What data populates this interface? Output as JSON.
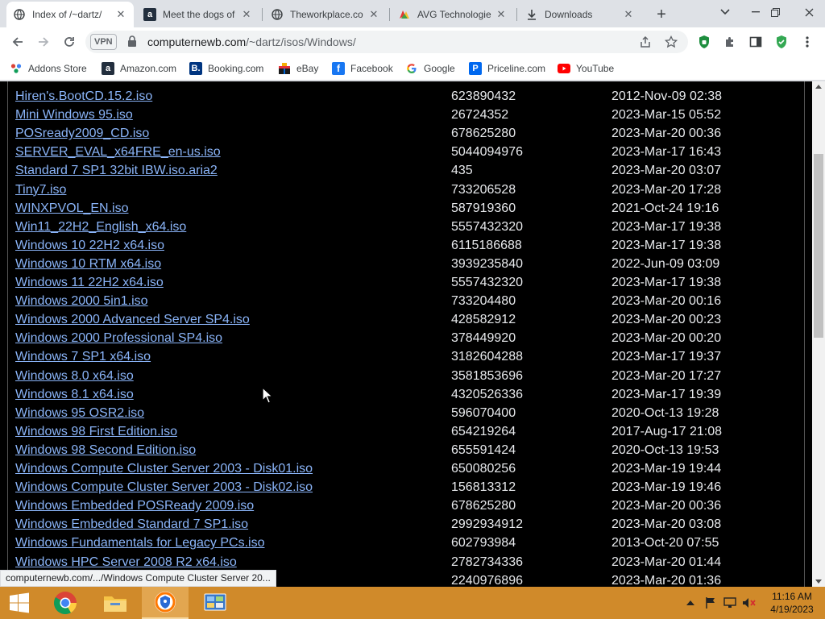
{
  "browser": {
    "tabs": [
      {
        "title": "Index of /~dartz/",
        "favicon": "globe-icon",
        "active": true
      },
      {
        "title": "Meet the dogs of",
        "favicon": "amazon-icon",
        "active": false
      },
      {
        "title": "Theworkplace.co",
        "favicon": "globe-icon",
        "active": false
      },
      {
        "title": "AVG Technologie",
        "favicon": "avg-icon",
        "active": false
      },
      {
        "title": "Downloads",
        "favicon": "download-icon",
        "active": false
      }
    ],
    "vpn_label": "VPN",
    "url_domain": "computernewb.com",
    "url_path": "/~dartz/isos/Windows/",
    "bookmarks": [
      {
        "label": "Addons Store",
        "icon": "addons-store-icon"
      },
      {
        "label": "Amazon.com",
        "icon": "amazon-icon"
      },
      {
        "label": "Booking.com",
        "icon": "booking-icon"
      },
      {
        "label": "eBay",
        "icon": "ebay-icon"
      },
      {
        "label": "Facebook",
        "icon": "facebook-icon"
      },
      {
        "label": "Google",
        "icon": "google-icon"
      },
      {
        "label": "Priceline.com",
        "icon": "priceline-icon"
      },
      {
        "label": "YouTube",
        "icon": "youtube-icon"
      }
    ],
    "status_url": "computernewb.com/.../Windows Compute Cluster Server 20..."
  },
  "listing": {
    "rows": [
      {
        "name": "Hiren's.BootCD.15.2.iso",
        "size": "623890432",
        "date": "2012-Nov-09 02:38"
      },
      {
        "name": "Mini Windows 95.iso",
        "size": "26724352",
        "date": "2023-Mar-15 05:52"
      },
      {
        "name": "POSready2009_CD.iso",
        "size": "678625280",
        "date": "2023-Mar-20 00:36"
      },
      {
        "name": "SERVER_EVAL_x64FRE_en-us.iso",
        "size": "5044094976",
        "date": "2023-Mar-17 16:43"
      },
      {
        "name": "Standard 7 SP1 32bit IBW.iso.aria2",
        "size": "435",
        "date": "2023-Mar-20 03:07"
      },
      {
        "name": "Tiny7.iso",
        "size": "733206528",
        "date": "2023-Mar-20 17:28"
      },
      {
        "name": "WINXPVOL_EN.iso",
        "size": "587919360",
        "date": "2021-Oct-24 19:16"
      },
      {
        "name": "Win11_22H2_English_x64.iso",
        "size": "5557432320",
        "date": "2023-Mar-17 19:38"
      },
      {
        "name": "Windows 10 22H2 x64.iso",
        "size": "6115186688",
        "date": "2023-Mar-17 19:38"
      },
      {
        "name": "Windows 10 RTM x64.iso",
        "size": "3939235840",
        "date": "2022-Jun-09 03:09"
      },
      {
        "name": "Windows 11 22H2 x64.iso",
        "size": "5557432320",
        "date": "2023-Mar-17 19:38"
      },
      {
        "name": "Windows 2000 5in1.iso",
        "size": "733204480",
        "date": "2023-Mar-20 00:16"
      },
      {
        "name": "Windows 2000 Advanced Server SP4.iso",
        "size": "428582912",
        "date": "2023-Mar-20 00:23"
      },
      {
        "name": "Windows 2000 Professional SP4.iso",
        "size": "378449920",
        "date": "2023-Mar-20 00:20"
      },
      {
        "name": "Windows 7 SP1 x64.iso",
        "size": "3182604288",
        "date": "2023-Mar-17 19:37"
      },
      {
        "name": "Windows 8.0 x64.iso",
        "size": "3581853696",
        "date": "2023-Mar-20 17:27"
      },
      {
        "name": "Windows 8.1 x64.iso",
        "size": "4320526336",
        "date": "2023-Mar-17 19:39"
      },
      {
        "name": "Windows 95 OSR2.iso",
        "size": "596070400",
        "date": "2020-Oct-13 19:28"
      },
      {
        "name": "Windows 98 First Edition.iso",
        "size": "654219264",
        "date": "2017-Aug-17 21:08"
      },
      {
        "name": "Windows 98 Second Edition.iso",
        "size": "655591424",
        "date": "2020-Oct-13 19:53"
      },
      {
        "name": "Windows Compute Cluster Server 2003 - Disk01.iso",
        "size": "650080256",
        "date": "2023-Mar-19 19:44"
      },
      {
        "name": "Windows Compute Cluster Server 2003 - Disk02.iso",
        "size": "156813312",
        "date": "2023-Mar-19 19:46"
      },
      {
        "name": "Windows Embedded POSReady 2009.iso",
        "size": "678625280",
        "date": "2023-Mar-20 00:36"
      },
      {
        "name": "Windows Embedded Standard 7 SP1.iso",
        "size": "2992934912",
        "date": "2023-Mar-20 03:08"
      },
      {
        "name": "Windows Fundamentals for Legacy PCs.iso",
        "size": "602793984",
        "date": "2013-Oct-20 07:55"
      },
      {
        "name": "Windows HPC Server 2008 R2 x64.iso",
        "size": "2782734336",
        "date": "2023-Mar-20 01:44"
      },
      {
        "name": "",
        "size": "2240976896",
        "date": "2023-Mar-20 01:36"
      }
    ]
  },
  "taskbar": {
    "apps": [
      "chrome-icon",
      "file-explorer-icon",
      "avast-secure-browser-icon",
      "control-panel-icon"
    ],
    "clock_time": "11:16 AM",
    "clock_date": "4/19/2023"
  },
  "colors": {
    "link": "#8ab4f8",
    "page_bg": "#000000",
    "taskbar_bg": "#d08a2a"
  }
}
